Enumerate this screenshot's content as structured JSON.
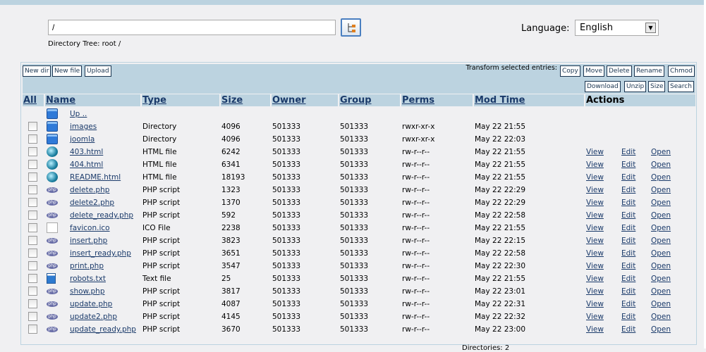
{
  "path_input": {
    "value": "/"
  },
  "directory_tree": "Directory Tree: root /",
  "language": {
    "label": "Language:",
    "selected": "English"
  },
  "toolbar": {
    "new_dir": "New dir",
    "new_file": "New file",
    "upload": "Upload",
    "transform_label": "Transform selected entries:",
    "copy": "Copy",
    "move": "Move",
    "delete": "Delete",
    "rename": "Rename",
    "chmod": "Chmod",
    "download": "Download",
    "unzip": "Unzip",
    "size": "Size",
    "search": "Search"
  },
  "columns": {
    "all": "All",
    "name": "Name",
    "type": "Type",
    "size": "Size",
    "owner": "Owner",
    "group": "Group",
    "perms": "Perms",
    "mod_time": "Mod Time",
    "actions": "Actions"
  },
  "up_label": "Up ..",
  "actions": {
    "view": "View",
    "edit": "Edit",
    "open": "Open"
  },
  "rows": [
    {
      "icon": "folder",
      "name": "images",
      "type": "Directory",
      "size": "4096",
      "owner": "501333",
      "group": "501333",
      "perms": "rwxr-xr-x",
      "mod": "May 22 21:55",
      "actions": false
    },
    {
      "icon": "folder",
      "name": "joomla",
      "type": "Directory",
      "size": "4096",
      "owner": "501333",
      "group": "501333",
      "perms": "rwxr-xr-x",
      "mod": "May 22 22:03",
      "actions": false
    },
    {
      "icon": "globe",
      "name": "403.html",
      "type": "HTML file",
      "size": "6242",
      "owner": "501333",
      "group": "501333",
      "perms": "rw-r--r--",
      "mod": "May 22 21:55",
      "actions": true
    },
    {
      "icon": "globe",
      "name": "404.html",
      "type": "HTML file",
      "size": "6341",
      "owner": "501333",
      "group": "501333",
      "perms": "rw-r--r--",
      "mod": "May 22 21:55",
      "actions": true
    },
    {
      "icon": "globe",
      "name": "README.html",
      "type": "HTML file",
      "size": "18193",
      "owner": "501333",
      "group": "501333",
      "perms": "rw-r--r--",
      "mod": "May 22 21:55",
      "actions": true
    },
    {
      "icon": "php",
      "name": "delete.php",
      "type": "PHP script",
      "size": "1323",
      "owner": "501333",
      "group": "501333",
      "perms": "rw-r--r--",
      "mod": "May 22 22:29",
      "actions": true
    },
    {
      "icon": "php",
      "name": "delete2.php",
      "type": "PHP script",
      "size": "1370",
      "owner": "501333",
      "group": "501333",
      "perms": "rw-r--r--",
      "mod": "May 22 22:29",
      "actions": true
    },
    {
      "icon": "php",
      "name": "delete_ready.php",
      "type": "PHP script",
      "size": "592",
      "owner": "501333",
      "group": "501333",
      "perms": "rw-r--r--",
      "mod": "May 22 22:58",
      "actions": true
    },
    {
      "icon": "ico",
      "name": "favicon.ico",
      "type": "ICO File",
      "size": "2238",
      "owner": "501333",
      "group": "501333",
      "perms": "rw-r--r--",
      "mod": "May 22 21:55",
      "actions": true
    },
    {
      "icon": "php",
      "name": "insert.php",
      "type": "PHP script",
      "size": "3823",
      "owner": "501333",
      "group": "501333",
      "perms": "rw-r--r--",
      "mod": "May 22 22:15",
      "actions": true
    },
    {
      "icon": "php",
      "name": "insert_ready.php",
      "type": "PHP script",
      "size": "3651",
      "owner": "501333",
      "group": "501333",
      "perms": "rw-r--r--",
      "mod": "May 22 22:58",
      "actions": true
    },
    {
      "icon": "php",
      "name": "print.php",
      "type": "PHP script",
      "size": "3547",
      "owner": "501333",
      "group": "501333",
      "perms": "rw-r--r--",
      "mod": "May 22 22:30",
      "actions": true
    },
    {
      "icon": "txt",
      "name": "robots.txt",
      "type": "Text file",
      "size": "25",
      "owner": "501333",
      "group": "501333",
      "perms": "rw-r--r--",
      "mod": "May 22 21:55",
      "actions": true
    },
    {
      "icon": "php",
      "name": "show.php",
      "type": "PHP script",
      "size": "3817",
      "owner": "501333",
      "group": "501333",
      "perms": "rw-r--r--",
      "mod": "May 22 23:01",
      "actions": true
    },
    {
      "icon": "php",
      "name": "update.php",
      "type": "PHP script",
      "size": "4087",
      "owner": "501333",
      "group": "501333",
      "perms": "rw-r--r--",
      "mod": "May 22 22:31",
      "actions": true
    },
    {
      "icon": "php",
      "name": "update2.php",
      "type": "PHP script",
      "size": "4145",
      "owner": "501333",
      "group": "501333",
      "perms": "rw-r--r--",
      "mod": "May 22 22:32",
      "actions": true
    },
    {
      "icon": "php",
      "name": "update_ready.php",
      "type": "PHP script",
      "size": "3670",
      "owner": "501333",
      "group": "501333",
      "perms": "rw-r--r--",
      "mod": "May 22 23:00",
      "actions": true
    }
  ],
  "footer_partial": "Directories: 2"
}
